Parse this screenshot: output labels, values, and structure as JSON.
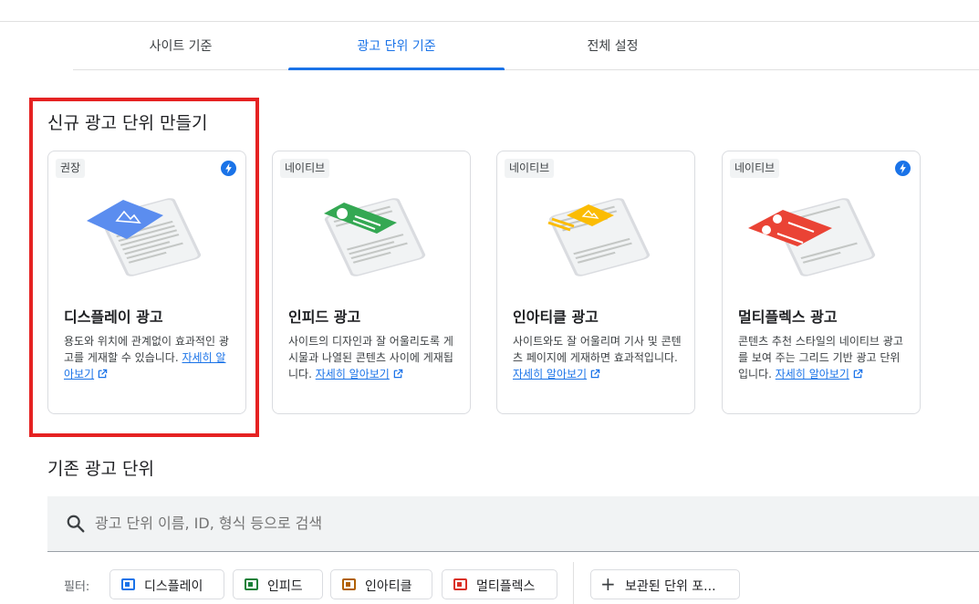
{
  "tabs": [
    {
      "label": "사이트 기준"
    },
    {
      "label": "광고 단위 기준"
    },
    {
      "label": "전체 설정"
    }
  ],
  "new_section": {
    "title": "신규 광고 단위 만들기"
  },
  "cards": [
    {
      "badge": "권장",
      "title": "디스플레이 광고",
      "description": "용도와 위치에 관계없이 효과적인 광고를 게재할 수 있습니다.",
      "link": "자세히 알아보기",
      "accent": "#5b8def",
      "lightning": true
    },
    {
      "badge": "네이티브",
      "title": "인피드 광고",
      "description": "사이트의 디자인과 잘 어울리도록 게시물과 나열된 콘텐츠 사이에 게재됩니다.",
      "link": "자세히 알아보기",
      "accent": "#34a853",
      "lightning": false
    },
    {
      "badge": "네이티브",
      "title": "인아티클 광고",
      "description": "사이트와도 잘 어울리며 기사 및 콘텐츠 페이지에 게재하면 효과적입니다.",
      "link": "자세히 알아보기",
      "accent": "#fbbc04",
      "lightning": false
    },
    {
      "badge": "네이티브",
      "title": "멀티플렉스 광고",
      "description": "콘텐츠 추천 스타일의 네이티브 광고를 보여 주는 그리드 기반 광고 단위입니다.",
      "link": "자세히 알아보기",
      "accent": "#ea4335",
      "lightning": true
    }
  ],
  "existing_section": {
    "title": "기존 광고 단위"
  },
  "search": {
    "placeholder": "광고 단위 이름, ID, 형식 등으로 검색"
  },
  "filters": {
    "label": "필터:",
    "chips": [
      {
        "label": "디스플레이",
        "color": "#1a73e8"
      },
      {
        "label": "인피드",
        "color": "#188038"
      },
      {
        "label": "인아티클",
        "color": "#b06000"
      },
      {
        "label": "멀티플렉스",
        "color": "#d93025"
      }
    ],
    "archived": "보관된 단위 포..."
  },
  "colors": {
    "primary": "#1a73e8",
    "highlight": "#e52222"
  }
}
